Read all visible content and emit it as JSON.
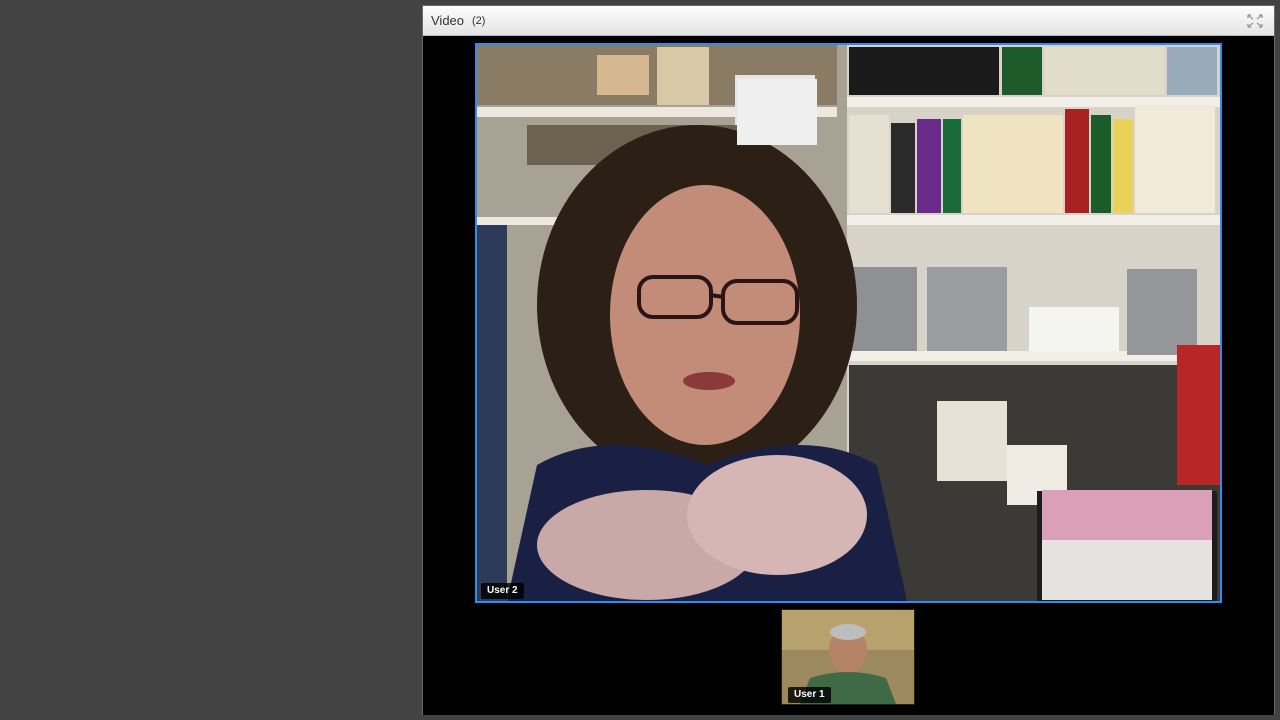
{
  "pod": {
    "title": "Video",
    "count": "(2)",
    "fullscreen_icon": "fullscreen-icon"
  },
  "participants": {
    "main": {
      "label": "User 2"
    },
    "thumbnail": {
      "label": "User 1"
    }
  },
  "colors": {
    "active_speaker_border": "#2f8cf0",
    "pod_background": "#000000",
    "app_background": "#434343"
  }
}
